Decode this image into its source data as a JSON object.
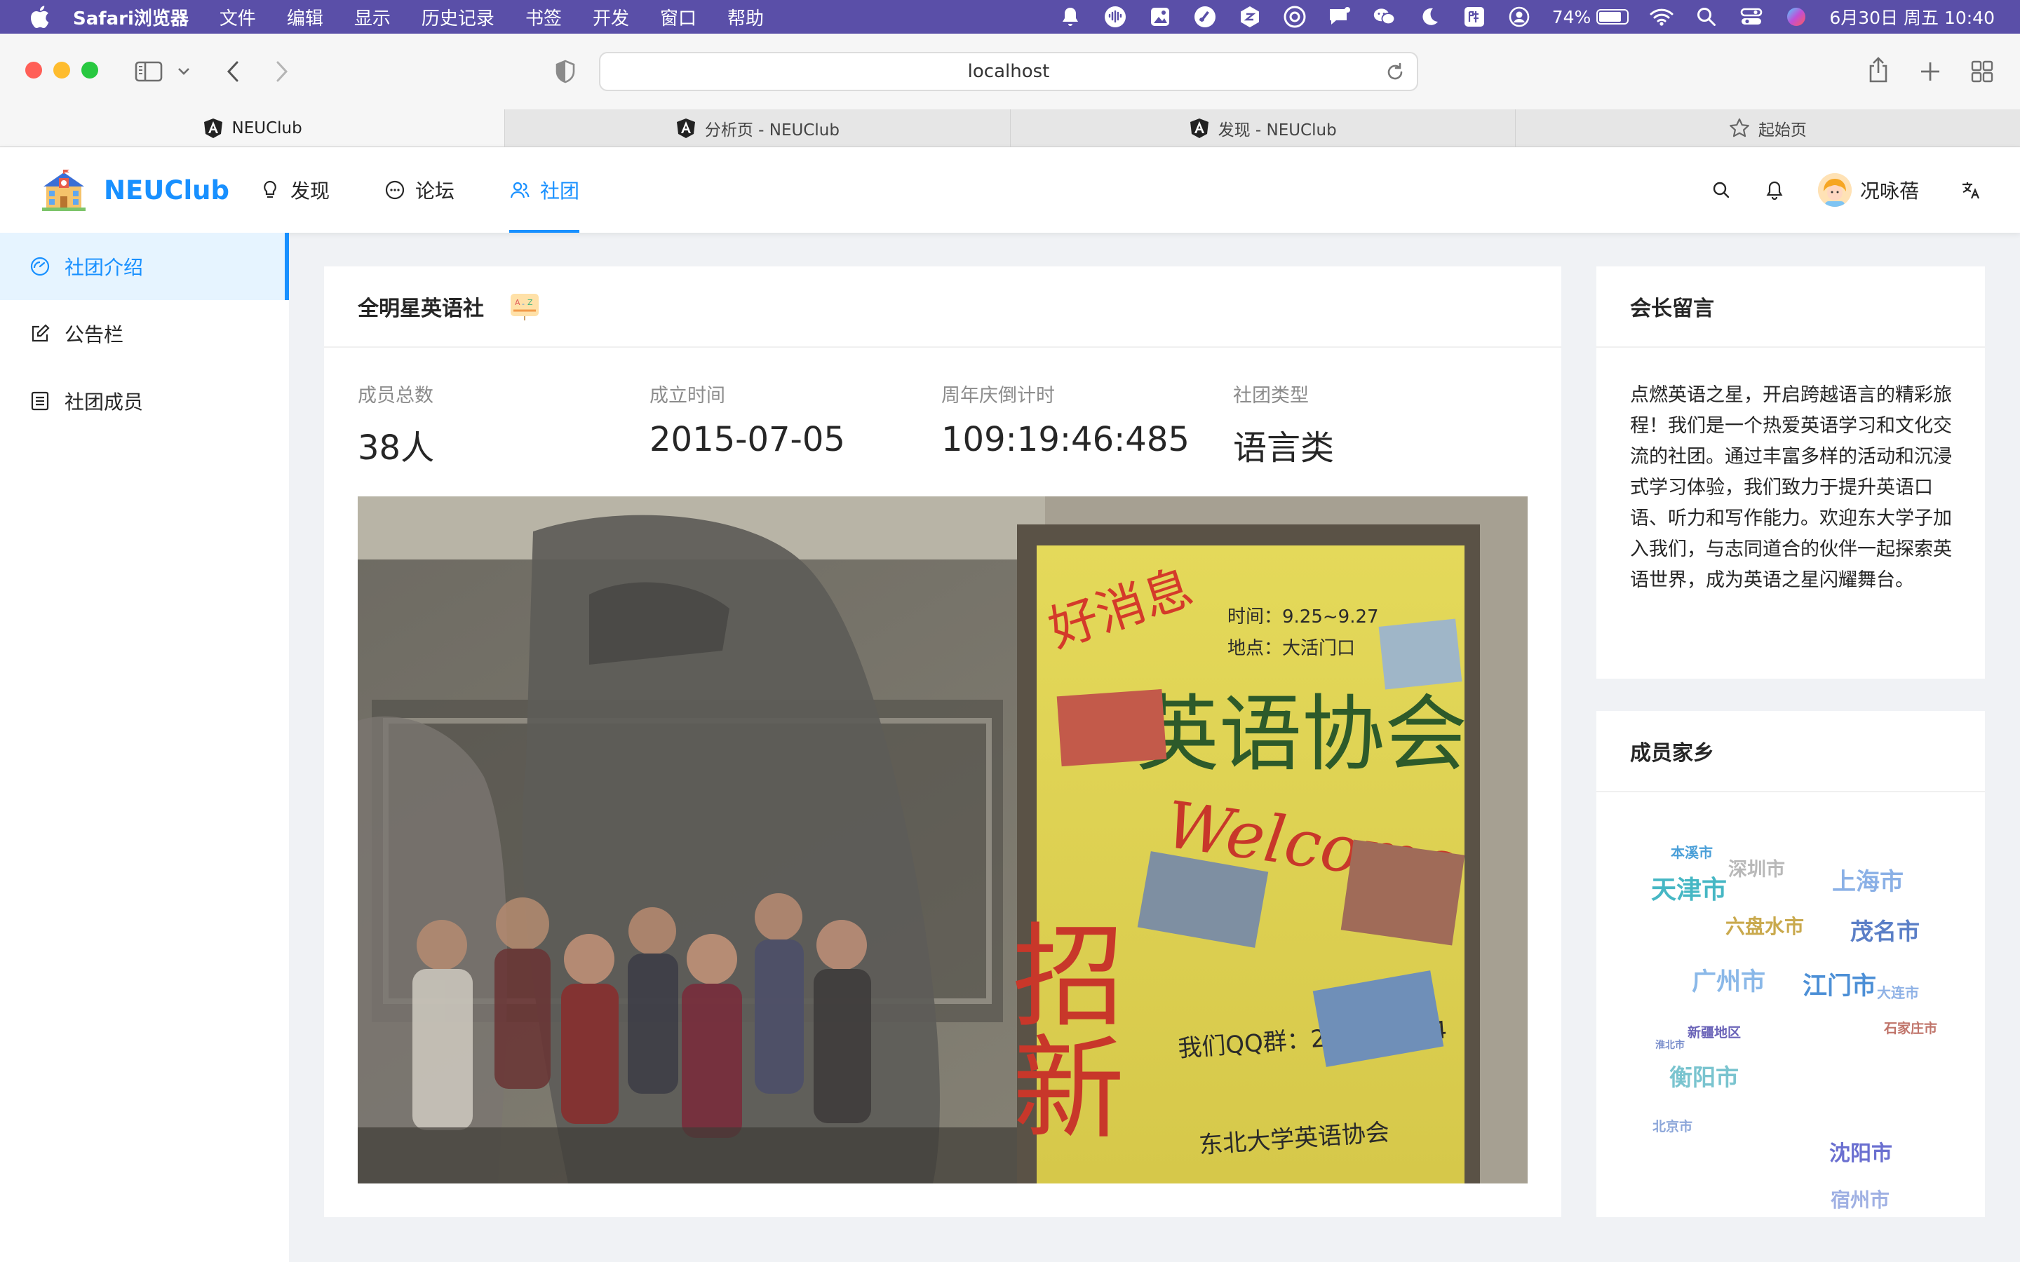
{
  "menubar": {
    "app_name": "Safari浏览器",
    "items": [
      "文件",
      "编辑",
      "显示",
      "历史记录",
      "书签",
      "开发",
      "窗口",
      "帮助"
    ],
    "battery": "74%",
    "datetime": "6月30日 周五  10:40"
  },
  "browser": {
    "url": "localhost",
    "tabs": [
      {
        "label": "NEUClub",
        "icon": "angular-icon",
        "active": true
      },
      {
        "label": "分析页 - NEUClub",
        "icon": "angular-icon",
        "active": false
      },
      {
        "label": "发现 - NEUClub",
        "icon": "angular-icon",
        "active": false
      },
      {
        "label": "起始页",
        "icon": "star-icon",
        "active": false
      }
    ]
  },
  "header": {
    "brand": "NEUClub",
    "nav": [
      {
        "label": "发现",
        "icon": "bulb-icon"
      },
      {
        "label": "论坛",
        "icon": "message-icon"
      },
      {
        "label": "社团",
        "icon": "team-icon"
      }
    ],
    "active_nav": "社团",
    "username": "况咏蓓"
  },
  "sidebar": {
    "items": [
      {
        "label": "社团介绍",
        "icon": "dashboard-icon"
      },
      {
        "label": "公告栏",
        "icon": "edit-icon"
      },
      {
        "label": "社团成员",
        "icon": "list-icon"
      }
    ],
    "active": "社团介绍"
  },
  "club": {
    "name": "全明星英语社",
    "stats": [
      {
        "label": "成员总数",
        "value": "38人"
      },
      {
        "label": "成立时间",
        "value": "2015-07-05"
      },
      {
        "label": "周年庆倒计时",
        "value": "109:19:46:485"
      },
      {
        "label": "社团类型",
        "value": "语言类"
      }
    ],
    "poster_text": {
      "headline": "英语协会",
      "handwriting": "Welcome",
      "slogan": "招新",
      "qq": "我们QQ群：223867784",
      "time": "时间：9.25~9.27",
      "place": "地点：大活门口",
      "host": "东北大学英语协会"
    }
  },
  "president": {
    "title": "会长留言",
    "message": "点燃英语之星，开启跨越语言的精彩旅程！我们是一个热爱英语学习和文化交流的社团。通过丰富多样的活动和沉浸式学习体验，我们致力于提升英语口语、听力和写作能力。欢迎东大学子加入我们，与志同道合的伙伴一起探索英语世界，成为英语之星闪耀舞台。"
  },
  "hometown": {
    "title": "成员家乡",
    "words": [
      {
        "text": "本溪市",
        "color": "#4a9fd8"
      },
      {
        "text": "深圳市",
        "color": "#b8b8b8"
      },
      {
        "text": "天津市",
        "color": "#46b7c4"
      },
      {
        "text": "上海市",
        "color": "#8ab0e6"
      },
      {
        "text": "六盘水市",
        "color": "#c9a94d"
      },
      {
        "text": "茂名市",
        "color": "#5b7fc7"
      },
      {
        "text": "广州市",
        "color": "#8ab8e8"
      },
      {
        "text": "江门市",
        "color": "#4c8fd6"
      },
      {
        "text": "大连市",
        "color": "#8fb2e6"
      },
      {
        "text": "新疆地区",
        "color": "#6a63b8"
      },
      {
        "text": "石家庄市",
        "color": "#c0746a"
      },
      {
        "text": "淮北市",
        "color": "#7b8fcc"
      },
      {
        "text": "衡阳市",
        "color": "#7ac4cf"
      },
      {
        "text": "北京市",
        "color": "#8ca6d9"
      },
      {
        "text": "沈阳市",
        "color": "#6a6fd0"
      },
      {
        "text": "宿州市",
        "color": "#9fb0e3"
      }
    ]
  }
}
